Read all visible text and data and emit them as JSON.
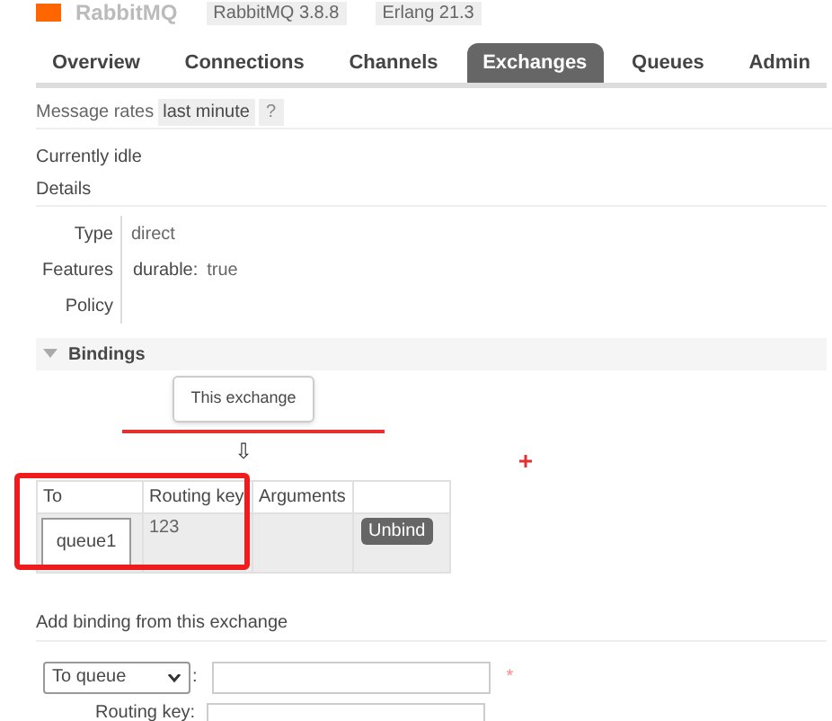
{
  "header": {
    "logo": "RabbitMQ",
    "badges": [
      "RabbitMQ 3.8.8",
      "Erlang 21.3"
    ]
  },
  "tabs": [
    {
      "label": "Overview",
      "selected": false
    },
    {
      "label": "Connections",
      "selected": false
    },
    {
      "label": "Channels",
      "selected": false
    },
    {
      "label": "Exchanges",
      "selected": true
    },
    {
      "label": "Queues",
      "selected": false
    },
    {
      "label": "Admin",
      "selected": false
    }
  ],
  "message_rates": {
    "label": "Message rates",
    "value": "last minute",
    "help": "?"
  },
  "status": "Currently idle",
  "details": {
    "title": "Details",
    "rows": [
      {
        "label": "Type",
        "value": "direct"
      },
      {
        "label": "Features",
        "key": "durable:",
        "value": "true"
      },
      {
        "label": "Policy"
      }
    ]
  },
  "bindings": {
    "title": "Bindings",
    "expanded": true,
    "source": "This exchange",
    "arrow": "⇩",
    "columns": [
      "To",
      "Routing key",
      "Arguments"
    ],
    "rows": [
      {
        "to": "queue1",
        "routing_key": "123",
        "action": "Unbind"
      }
    ]
  },
  "add_binding": {
    "title": "Add binding from this exchange",
    "destination": "To queue",
    "separator": ":",
    "required_mark": "*",
    "routing_key_label": "Routing key:"
  }
}
